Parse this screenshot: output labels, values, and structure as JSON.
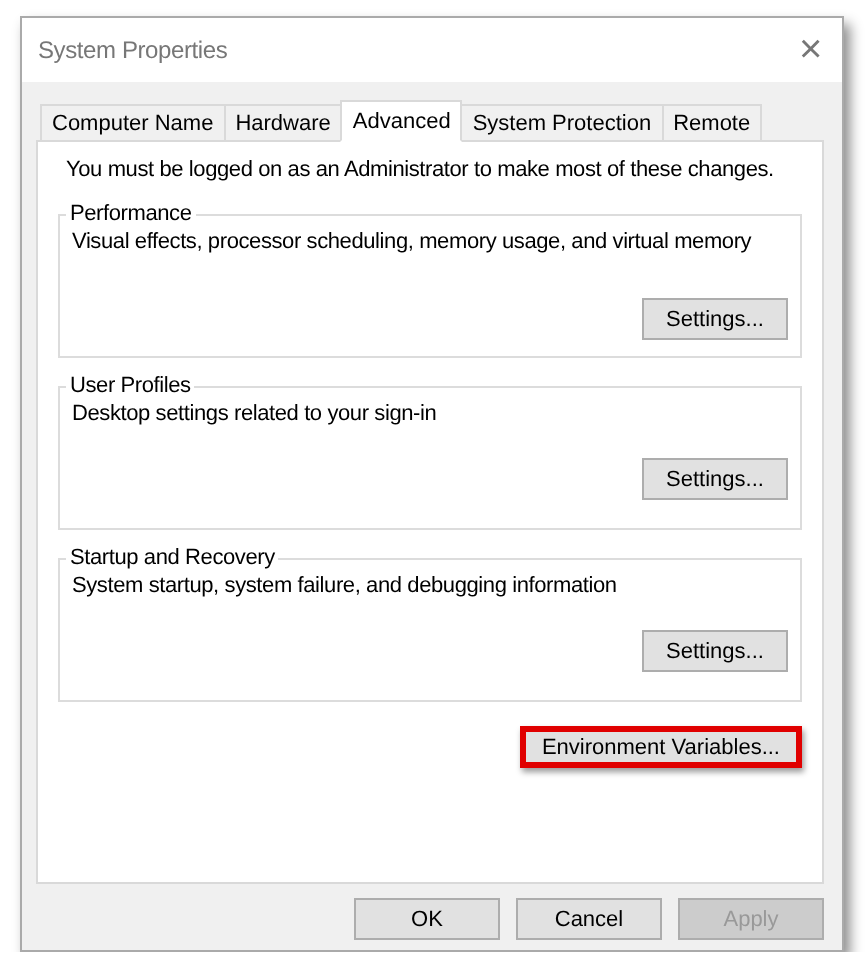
{
  "window": {
    "title": "System Properties",
    "close": "×"
  },
  "tabs": [
    {
      "label": "Computer Name",
      "selected": false
    },
    {
      "label": "Hardware",
      "selected": false
    },
    {
      "label": "Advanced",
      "selected": true
    },
    {
      "label": "System Protection",
      "selected": false
    },
    {
      "label": "Remote",
      "selected": false
    }
  ],
  "notice": "You must be logged on as an Administrator to make most of these changes.",
  "groups": [
    {
      "title": "Performance",
      "description": "Visual effects, processor scheduling, memory usage, and virtual memory",
      "button": "Settings..."
    },
    {
      "title": "User Profiles",
      "description": "Desktop settings related to your sign-in",
      "button": "Settings..."
    },
    {
      "title": "Startup and Recovery",
      "description": "System startup, system failure, and debugging information",
      "button": "Settings..."
    }
  ],
  "environment_button": {
    "label": "Environment Variables...",
    "highlighted": true
  },
  "buttons": [
    {
      "label": "OK",
      "disabled": false
    },
    {
      "label": "Cancel",
      "disabled": false
    },
    {
      "label": "Apply",
      "disabled": true
    }
  ]
}
